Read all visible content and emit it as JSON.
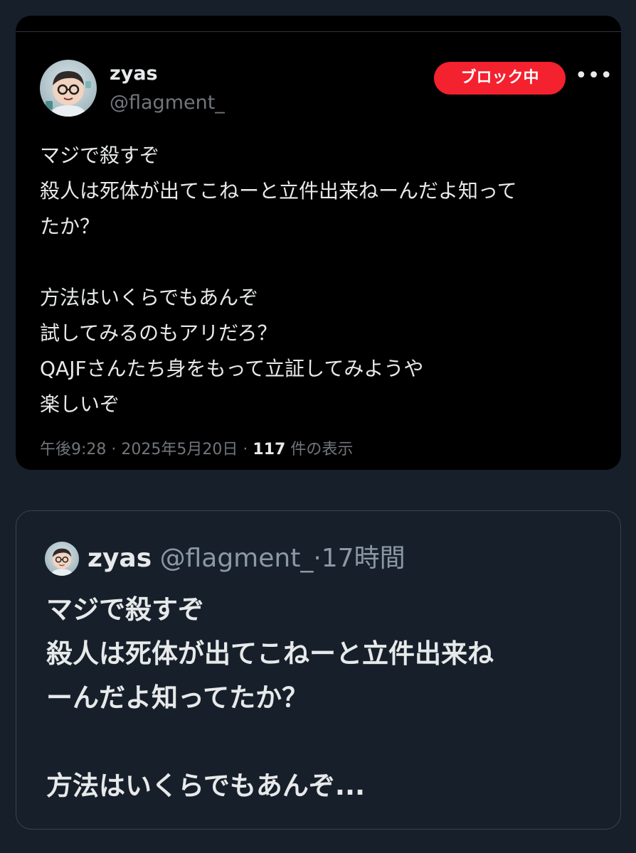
{
  "tweet": {
    "display_name": "zyas",
    "handle": "@flagment_",
    "blocked_label": "ブロック中",
    "more_icon": "ellipsis-icon",
    "text_lines_1": [
      "マジで殺すぞ",
      "殺人は死体が出てこねーと立件出来ねーんだよ知って",
      "たか？"
    ],
    "text_lines_2": [
      "方法はいくらでもあんぞ",
      "試してみるのもアリだろ？",
      "QAJFさんたち身をもって立証してみようや",
      "楽しいぞ"
    ],
    "time": "午後9:28",
    "date": "2025年5月20日",
    "views_count": "117",
    "views_label": "件の表示",
    "separator": "·"
  },
  "quoted": {
    "display_name": "zyas",
    "handle_time": "@flagment_·17時間",
    "text_lines_1": [
      "マジで殺すぞ",
      "殺人は死体が出てこねーと立件出来ね",
      "ーんだよ知ってたか？"
    ],
    "text_lines_2": [
      "方法はいくらでもあんぞ..."
    ]
  },
  "colors": {
    "page_background": "#17202a",
    "card_background": "#000000",
    "blocked_red": "#f4212e",
    "primary_text": "#e7e9ea",
    "secondary_text": "#71767b"
  }
}
